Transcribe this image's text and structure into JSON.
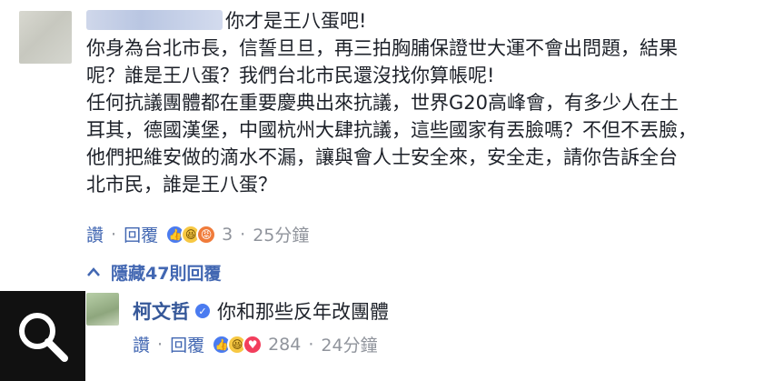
{
  "comment": {
    "author_suffix": "你才是王八蛋吧!",
    "body": "你身為台北市長，信誓旦旦，再三拍胸脯保證世大運不會出問題，結果\n呢？誰是王八蛋？我們台北市民還沒找你算帳呢!\n任何抗議團體都在重要慶典出來抗議，世界G20高峰會，有多少人在土\n耳其，德國漢堡，中國杭州大肆抗議，這些國家有丟臉嗎？不但不丟臉，\n他們把維安做的滴水不漏，讓與會人士安全來，安全走，請你告訴全台\n北市民，誰是王八蛋？",
    "like_label": "讚",
    "reply_label": "回覆",
    "reaction_count": "3",
    "time": "25分鐘"
  },
  "replies_toggle": {
    "label": "隱藏47則回覆"
  },
  "reply": {
    "author": "柯文哲",
    "text": "你和那些反年改團體",
    "like_label": "讚",
    "reply_label": "回覆",
    "reaction_count": "284",
    "time": "24分鐘"
  },
  "icons": {
    "search": "search-icon",
    "verified": "verified-badge-icon",
    "chevron": "chevron-up-icon"
  },
  "colors": {
    "link": "#4267b2",
    "meta": "#90949c",
    "text": "#1d2129",
    "overlay": "#111111"
  }
}
